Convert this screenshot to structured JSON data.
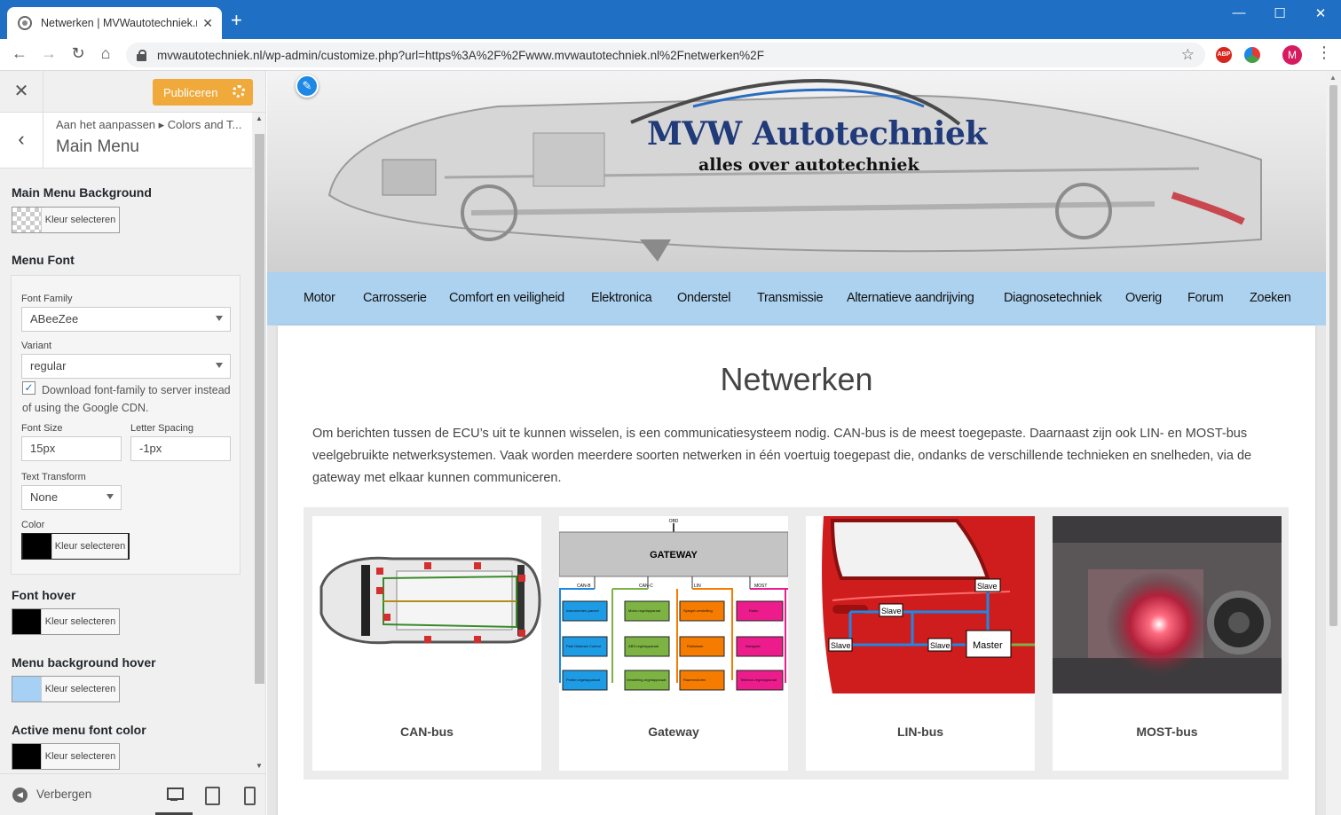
{
  "browser": {
    "tab_title": "Netwerken | MVWautotechniek.nl",
    "new_tab": "+",
    "url": "mvwautotechniek.nl/wp-admin/customize.php?url=https%3A%2F%2Fwww.mvwautotechniek.nl%2Fnetwerken%2F",
    "profile_initial": "M",
    "abp_label": "ABP"
  },
  "customizer": {
    "publish_label": "Publiceren",
    "breadcrumb": "Aan het aanpassen  ▸  Colors and T...",
    "section_title": "Main Menu",
    "choose_color": "Kleur selecteren",
    "main_menu_background": "Main Menu Background",
    "menu_font": "Menu Font",
    "font_family_label": "Font Family",
    "font_family_value": "ABeeZee",
    "variant_label": "Variant",
    "variant_value": "regular",
    "download_font_text": "Download font-family to server instead of using the Google CDN.",
    "font_size_label": "Font Size",
    "font_size_value": "15px",
    "letter_spacing_label": "Letter Spacing",
    "letter_spacing_value": "-1px",
    "text_transform_label": "Text Transform",
    "text_transform_value": "None",
    "color_label": "Color",
    "font_hover": "Font hover",
    "menu_background_hover": "Menu background hover",
    "active_menu_font_color": "Active menu font color",
    "hide_label": "Verbergen",
    "colors": {
      "menu_font_color": "#000000",
      "font_hover": "#000000",
      "menu_background_hover": "#a6d1f5",
      "active_menu_font_color": "#000000",
      "publish_button": "#f0a93b"
    }
  },
  "site": {
    "logo_title": "MVW Autotechniek",
    "logo_subtitle": "alles over autotechniek",
    "nav": [
      "Motor",
      "Carrosserie",
      "Comfort en veiligheid",
      "Elektronica",
      "Onderstel",
      "Transmissie",
      "Alternatieve aandrijving",
      "Diagnosetechniek",
      "Overig",
      "Forum",
      "Zoeken"
    ],
    "page_title": "Netwerken",
    "intro": "Om berichten tussen de ECU’s uit te kunnen wisselen, is een communicatiesysteem nodig. CAN-bus is de meest toegepaste. Daarnaast zijn ook LIN- en MOST-bus veelgebruikte netwerksystemen. Vaak worden meerdere soorten netwerken in één voertuig toegepast die, ondanks de verschillende technieken en snelheden, via de gateway met elkaar kunnen communiceren.",
    "cards": [
      {
        "caption": "CAN-bus"
      },
      {
        "caption": "Gateway"
      },
      {
        "caption": "LIN-bus"
      },
      {
        "caption": "MOST-bus"
      }
    ],
    "gateway_diagram": {
      "top_label": "OBD",
      "gateway_label": "GATEWAY",
      "bus_labels": [
        "CAN-B",
        "CAN-C",
        "LIN",
        "MOST"
      ],
      "modules": [
        "Instrumenten-paneel",
        "Motor-regelapparaat",
        "Spiegel-verstelling",
        "Radio",
        "Park Distance Control",
        "ABS-regelapparaat",
        "Ruitwisser",
        "Navigatie",
        "Portier-regelapparaat",
        "Verstelling-regelapparaat",
        "Raammotoren",
        "Telefoon-regelapparaat"
      ]
    },
    "lin_diagram": {
      "slave_label": "Slave",
      "master_label": "Master"
    }
  }
}
